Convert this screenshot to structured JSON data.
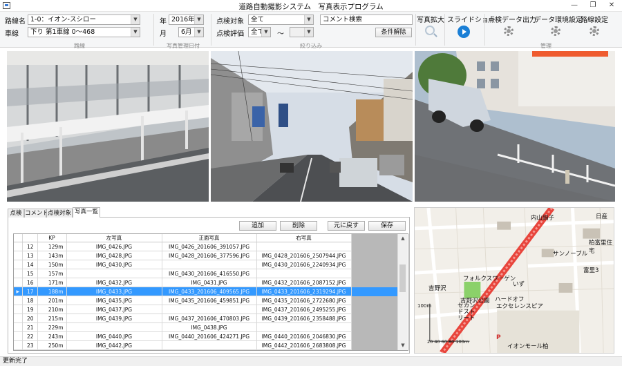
{
  "window": {
    "title": "道路自動撮影システム　写真表示プログラム",
    "min_glyph": "—",
    "restore_glyph": "❐",
    "close_glyph": "✕"
  },
  "ribbon": {
    "route": {
      "label": "路線名",
      "value": "1-0：イオン-スシロー"
    },
    "lane": {
      "label": "車線",
      "value": "下り 第1車線 0～468"
    },
    "route_group_label": "路線",
    "year": {
      "label": "年",
      "value": "2016年"
    },
    "month": {
      "label": "月",
      "value": "6月"
    },
    "date_group_label": "写真管理日付",
    "inspection_target": {
      "label": "点検対象",
      "value": "全て"
    },
    "inspection_eval": {
      "label": "点検評価",
      "value": "全て",
      "range_sep": "〜",
      "value_to": ""
    },
    "comment_search": {
      "value": "コメント検索"
    },
    "clear_button": "条件解除",
    "filter_group_label": "絞り込み",
    "photo_zoom": "写真拡大",
    "slideshow": "スライドショー",
    "export": "点検データ出力",
    "photo_env": "データ環境設定",
    "route_settings": "路線設定",
    "manage_group_label": "管理",
    "icons": {
      "zoom": "magnifier-icon",
      "slideshow": "play-icon",
      "gear": "gear-icon"
    },
    "accent": "#1a7fd6"
  },
  "photos": {
    "left": "left-camera-photo",
    "front": "front-camera-photo",
    "right": "right-camera-photo"
  },
  "tabs": [
    "点検",
    "コメント",
    "点検対象",
    "写真一覧"
  ],
  "active_tab": "写真一覧",
  "actions": {
    "add": "追加",
    "delete": "削除",
    "restore": "元に戻す",
    "save": "保存"
  },
  "grid": {
    "columns": [
      "",
      "",
      "KP",
      "左写真",
      "正面写真",
      "右写真"
    ],
    "rows": [
      {
        "ind": "",
        "idx": "12",
        "kp": "129m",
        "left": "IMG_0426.JPG",
        "front": "IMG_0426_201606_391057.JPG",
        "right": ""
      },
      {
        "ind": "",
        "idx": "13",
        "kp": "143m",
        "left": "IMG_0428.JPG",
        "front": "IMG_0428_201606_377596.JPG",
        "right": "IMG_0428_201606_2507944.JPG"
      },
      {
        "ind": "",
        "idx": "14",
        "kp": "150m",
        "left": "IMG_0430.JPG",
        "front": "",
        "right": "IMG_0430_201606_2240934.JPG"
      },
      {
        "ind": "",
        "idx": "15",
        "kp": "157m",
        "left": "",
        "front": "IMG_0430_201606_416550.JPG",
        "right": ""
      },
      {
        "ind": "",
        "idx": "16",
        "kp": "171m",
        "left": "IMG_0432.JPG",
        "front": "IMG_0431.JPG",
        "right": "IMG_0432_201606_2087152.JPG"
      },
      {
        "ind": "▶",
        "idx": "17",
        "kp": "188m",
        "left": "IMG_0433.JPG",
        "front": "IMG_0433_201606_409565.JPG",
        "right": "IMG_0433_201606_2319294.JPG",
        "selected": true
      },
      {
        "ind": "",
        "idx": "18",
        "kp": "201m",
        "left": "IMG_0435.JPG",
        "front": "IMG_0435_201606_459851.JPG",
        "right": "IMG_0435_201606_2722680.JPG"
      },
      {
        "ind": "",
        "idx": "19",
        "kp": "210m",
        "left": "IMG_0437.JPG",
        "front": "",
        "right": "IMG_0437_201606_2495255.JPG"
      },
      {
        "ind": "",
        "idx": "20",
        "kp": "215m",
        "left": "IMG_0439.JPG",
        "front": "IMG_0437_201606_470803.JPG",
        "right": "IMG_0439_201606_2358488.JPG"
      },
      {
        "ind": "",
        "idx": "21",
        "kp": "229m",
        "left": "",
        "front": "IMG_0438.JPG",
        "right": ""
      },
      {
        "ind": "",
        "idx": "22",
        "kp": "243m",
        "left": "IMG_0440.JPG",
        "front": "IMG_0440_201606_424271.JPG",
        "right": "IMG_0440_201606_2046830.JPG"
      },
      {
        "ind": "",
        "idx": "23",
        "kp": "250m",
        "left": "IMG_0442.JPG",
        "front": "",
        "right": "IMG_0442_201606_2683808.JPG"
      }
    ]
  },
  "map": {
    "labels": {
      "nissan": "日産",
      "uchiyama": "内山鍋子",
      "kashiwa_tomisato": "柏富里住宅",
      "sun_noble": "サンノーブル",
      "tomisato3": "富里3",
      "volkswagen": "フォルクスワーゲン",
      "yoshino": "吉野沢",
      "idzu": "いず",
      "yoshino_park": "吉野沢公園",
      "second_street": "セカンドストリート",
      "hard_off": "ハードオフ",
      "eco_center": "エクセレンスピア",
      "aeon": "イオンモール柏",
      "scale_100": "100m",
      "scale_bar": "20 40 60 80 100m",
      "parking": "P"
    },
    "route_color": "#e8453c",
    "park_color": "#8bd16a"
  },
  "status": "更新完了"
}
